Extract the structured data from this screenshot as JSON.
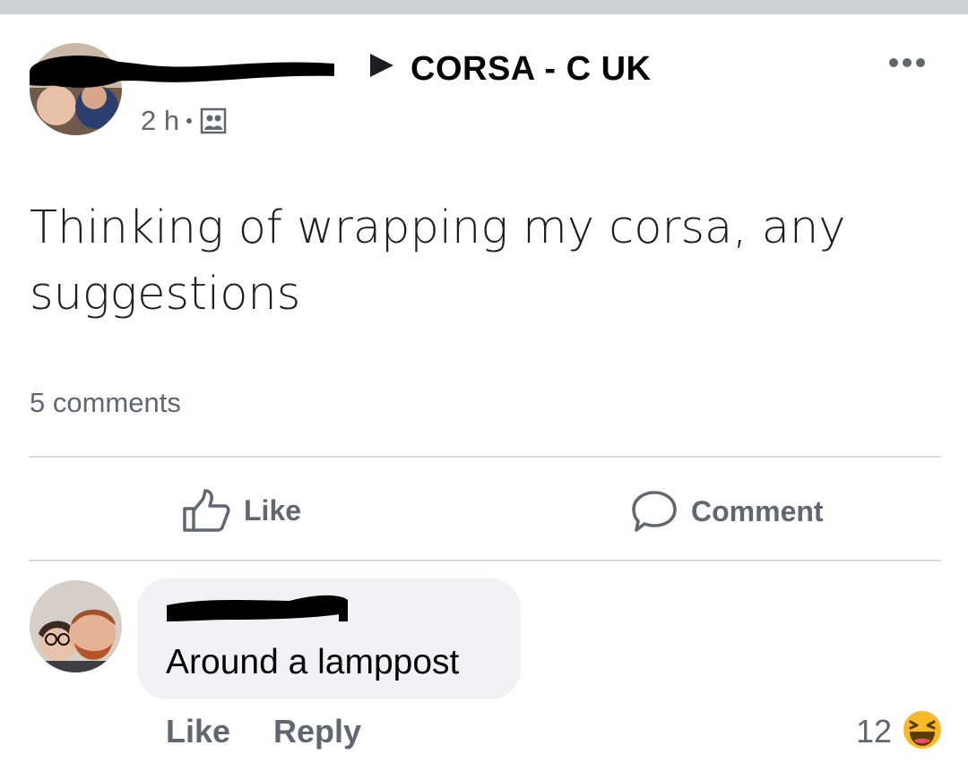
{
  "post": {
    "group_name": "CORSA - C UK",
    "time": "2 h",
    "text": "Thinking of wrapping my corsa, any suggestions",
    "comment_count": "5 comments",
    "actions": {
      "like": "Like",
      "comment": "Comment"
    }
  },
  "comment": {
    "text": "Around a lamppost",
    "actions": {
      "like": "Like",
      "reply": "Reply"
    },
    "reaction_count": "12",
    "reaction_type": "haha-icon"
  },
  "colors": {
    "topbar": "#cdd0d5",
    "muted_text": "#606770",
    "bubble_bg": "#f0f2f5",
    "divider": "#dadde1",
    "haha_yellow": "#f7b928"
  }
}
